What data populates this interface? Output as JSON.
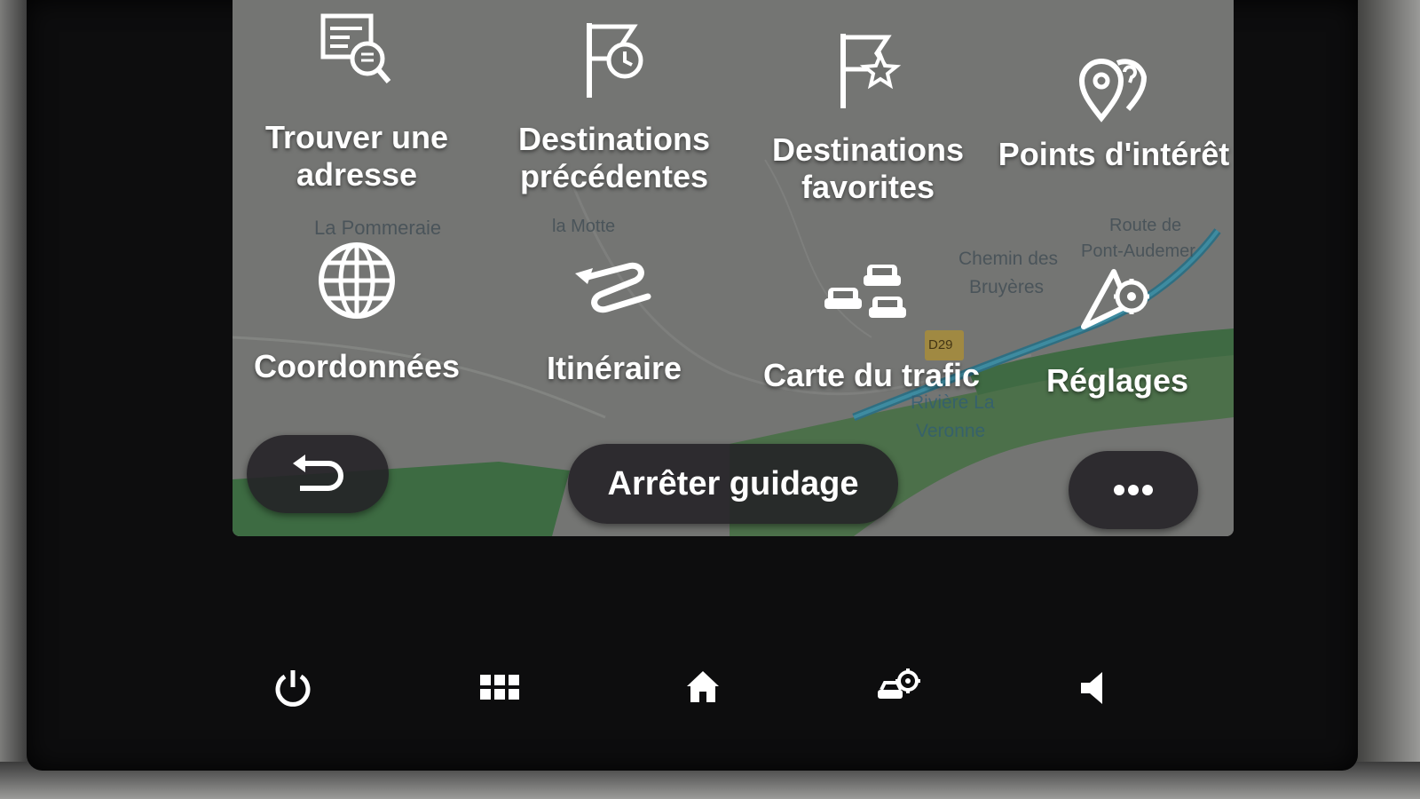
{
  "menu": {
    "items": [
      {
        "id": "find-address",
        "label_line1": "Trouver une",
        "label_line2": "adresse",
        "icon": "address-search-icon"
      },
      {
        "id": "previous-destinations",
        "label_line1": "Destinations",
        "label_line2": "précédentes",
        "icon": "flag-clock-icon"
      },
      {
        "id": "favorite-destinations",
        "label_line1": "Destinations",
        "label_line2": "favorites",
        "icon": "flag-star-icon"
      },
      {
        "id": "points-of-interest",
        "label_line1": "Points d'intérêt",
        "label_line2": "",
        "icon": "poi-pins-icon"
      },
      {
        "id": "coordinates",
        "label_line1": "Coordonnées",
        "label_line2": "",
        "icon": "globe-icon"
      },
      {
        "id": "itinerary",
        "label_line1": "Itinéraire",
        "label_line2": "",
        "icon": "route-icon"
      },
      {
        "id": "traffic-map",
        "label_line1": "Carte du trafic",
        "label_line2": "",
        "icon": "traffic-cars-icon"
      },
      {
        "id": "settings",
        "label_line1": "Réglages",
        "label_line2": "",
        "icon": "nav-settings-icon"
      }
    ]
  },
  "map": {
    "labels": [
      "La Pommeraie",
      "la Motte",
      "Chemin des",
      "Bruyères",
      "Route de",
      "Pont-Audemer",
      "Rivière La",
      "Veronne",
      "D29"
    ],
    "colors": {
      "land": "#737472",
      "green": "#3f6a43",
      "road": "#3e7e8f"
    }
  },
  "controls": {
    "back_icon": "back-arrow-icon",
    "stop_guidance_label": "Arrêter guidage",
    "more_icon": "more-dots-icon"
  },
  "system_bar": {
    "icons": [
      "power-icon",
      "apps-grid-icon",
      "home-icon",
      "car-settings-icon",
      "volume-icon"
    ]
  }
}
